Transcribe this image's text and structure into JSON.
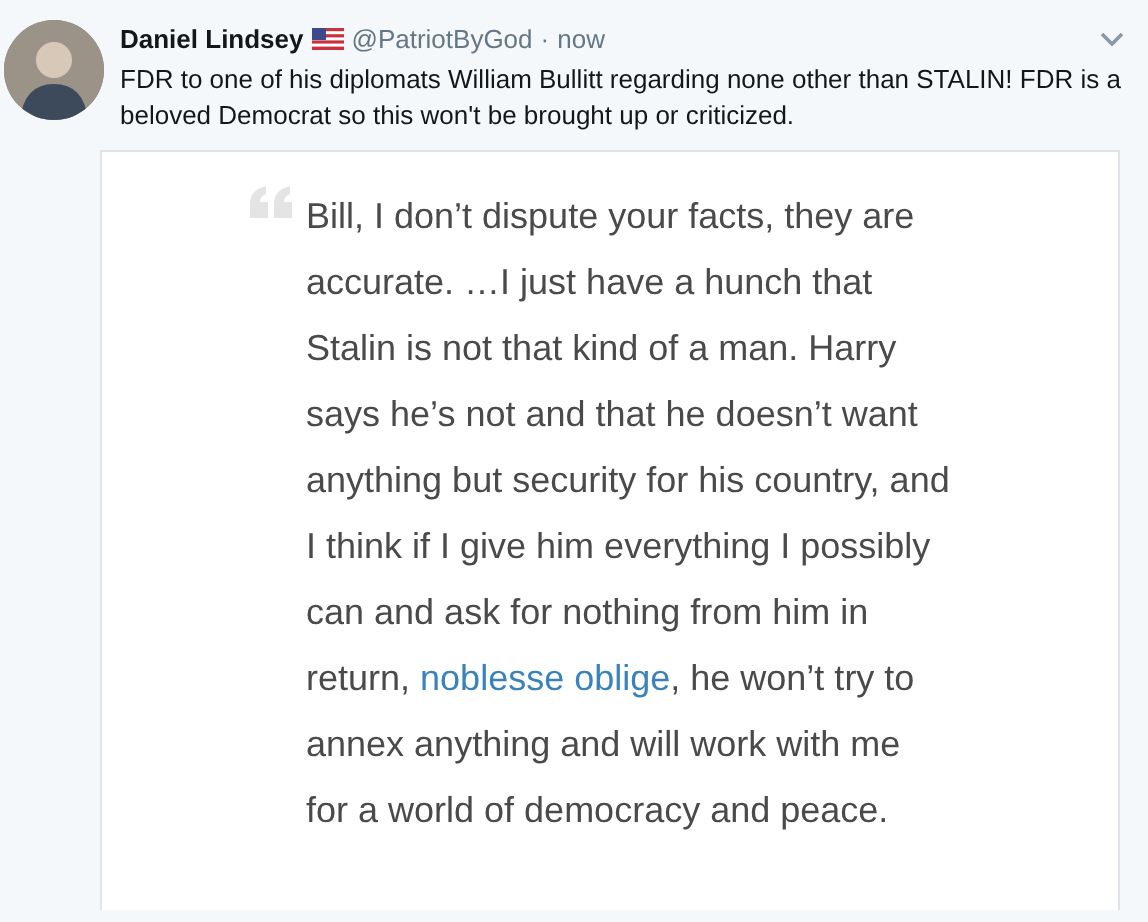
{
  "tweet": {
    "name": "Daniel Lindsey",
    "handle": "@PatriotByGod",
    "separator": "·",
    "time": "now",
    "text": "FDR to one of his diplomats William Bullitt regarding none other than STALIN! FDR is a beloved Democrat so this won't be brought up or criticized."
  },
  "quote": {
    "segments": [
      {
        "kind": "text",
        "text": "Bill, I don’t dispute your facts, they are accurate. …I just have a hunch that Stalin is not that kind of a man. Harry says he’s not and that he doesn’t want anything but security for his country, and I think if I give him everything I possibly can and ask for nothing from him in return, "
      },
      {
        "kind": "link",
        "text": "noblesse oblige"
      },
      {
        "kind": "text",
        "text": ", he won’t try to annex anything and will work with me for a world of democracy and peace."
      }
    ]
  }
}
